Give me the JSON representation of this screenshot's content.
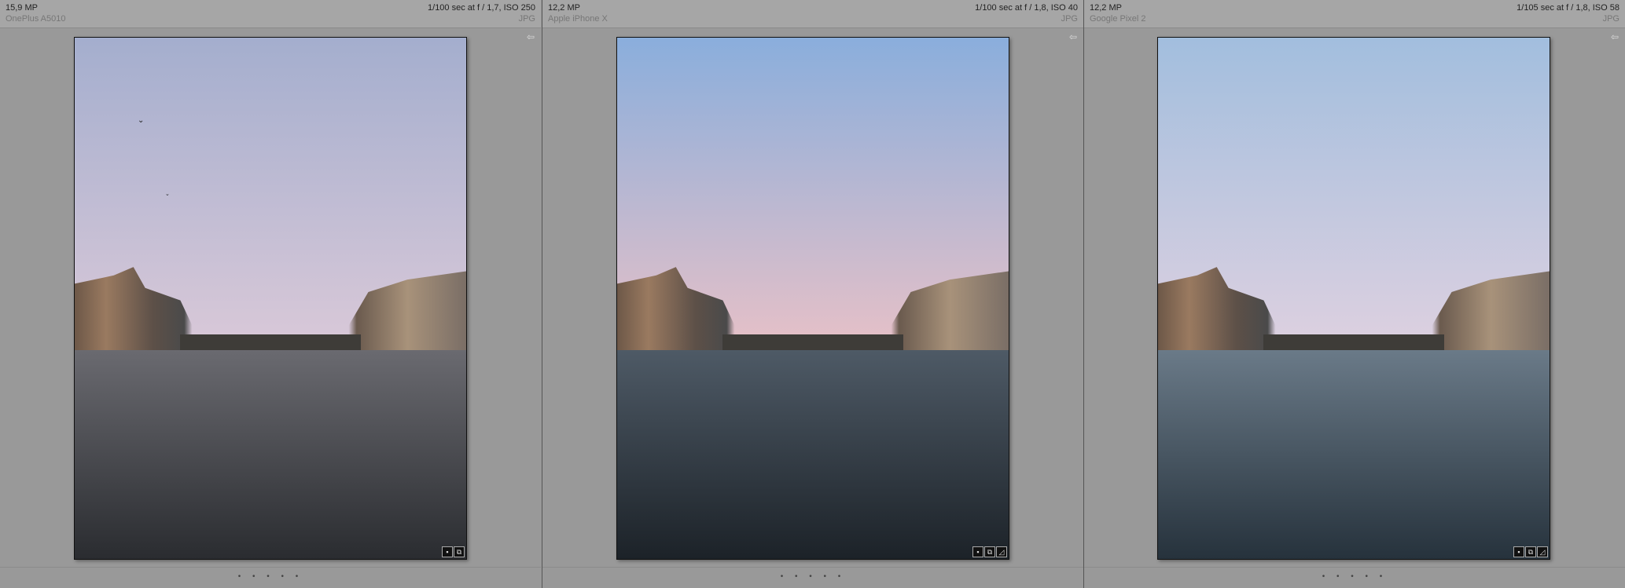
{
  "panels": [
    {
      "megapixels": "15,9 MP",
      "camera": "OnePlus A5010",
      "exposure": "1/100 sec at f / 1,7, ISO 250",
      "format": "JPG",
      "sky_top": "#a4aece",
      "sky_bottom": "#d8c8d8",
      "water_top": "#6a6a70",
      "water_bottom": "#2a2c30",
      "badges": [
        "comment-icon",
        "copy-icon"
      ]
    },
    {
      "megapixels": "12,2 MP",
      "camera": "Apple iPhone X",
      "exposure": "1/100 sec at f / 1,8, ISO 40",
      "format": "JPG",
      "sky_top": "#8aaedc",
      "sky_bottom": "#e4c0c8",
      "water_top": "#4e5a66",
      "water_bottom": "#1c2228",
      "badges": [
        "comment-icon",
        "copy-icon",
        "edit-icon"
      ]
    },
    {
      "megapixels": "12,2 MP",
      "camera": "Google Pixel 2",
      "exposure": "1/105 sec at f / 1,8, ISO 58",
      "format": "JPG",
      "sky_top": "#a2bede",
      "sky_bottom": "#dcd0e0",
      "water_top": "#6a7a88",
      "water_bottom": "#26323c",
      "badges": [
        "comment-icon",
        "copy-icon",
        "edit-icon"
      ]
    }
  ],
  "rating_dots": "• • • • •"
}
